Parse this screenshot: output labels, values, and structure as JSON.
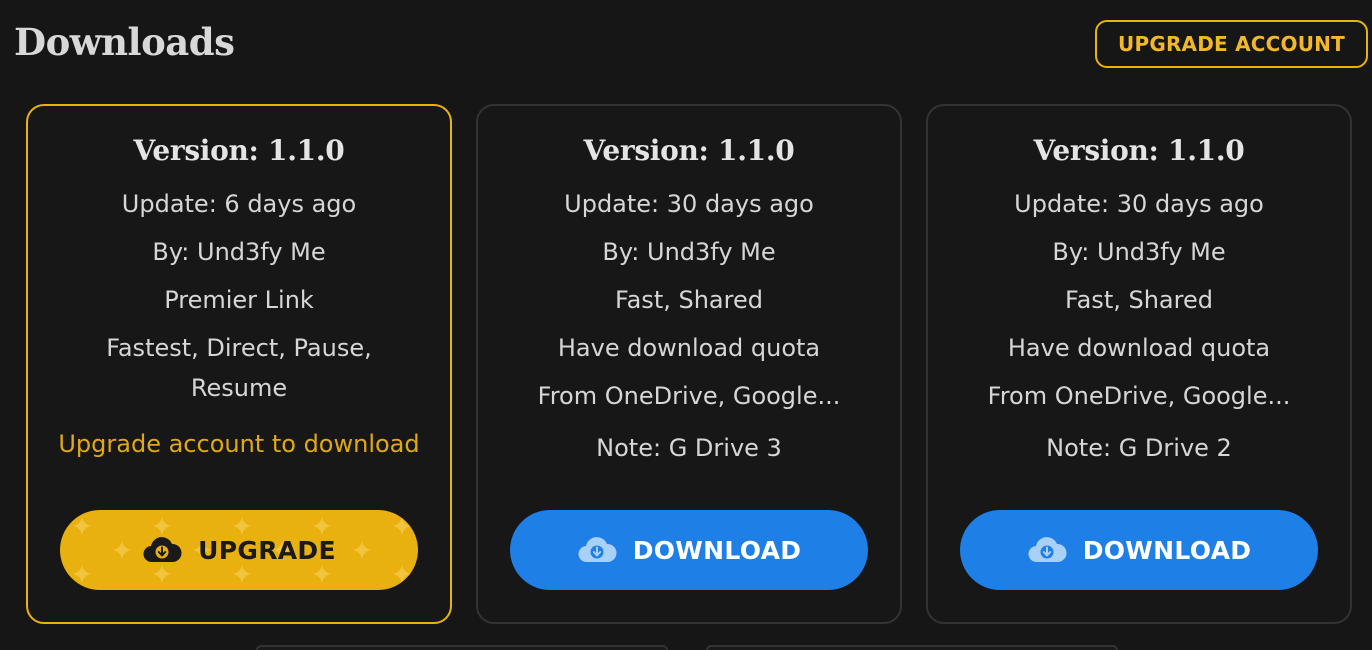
{
  "header": {
    "title": "Downloads",
    "upgrade_account_label": "UPGRADE ACCOUNT"
  },
  "cards": [
    {
      "version": "Version: 1.1.0",
      "update": "Update: 6 days ago",
      "by": "By: Und3fy Me",
      "link_type": "Premier Link",
      "features": "Fastest, Direct, Pause, Resume",
      "notice": "Upgrade account to download",
      "button_label": "UPGRADE",
      "button_icon": "cloud-download-icon"
    },
    {
      "version": "Version: 1.1.0",
      "update": "Update: 30 days ago",
      "by": "By: Und3fy Me",
      "link_type": "Fast, Shared",
      "quota": "Have download quota",
      "source": "From OneDrive, Google...",
      "note": "Note: G Drive 3",
      "button_label": "DOWNLOAD",
      "button_icon": "cloud-download-icon"
    },
    {
      "version": "Version: 1.1.0",
      "update": "Update: 30 days ago",
      "by": "By: Und3fy Me",
      "link_type": "Fast, Shared",
      "quota": "Have download quota",
      "source": "From OneDrive, Google...",
      "note": "Note: G Drive 2",
      "button_label": "DOWNLOAD",
      "button_icon": "cloud-download-icon"
    }
  ],
  "colors": {
    "background": "#161616",
    "premium_accent": "#eab308",
    "download_button": "#1e7fe6",
    "card_border": "#333333"
  }
}
